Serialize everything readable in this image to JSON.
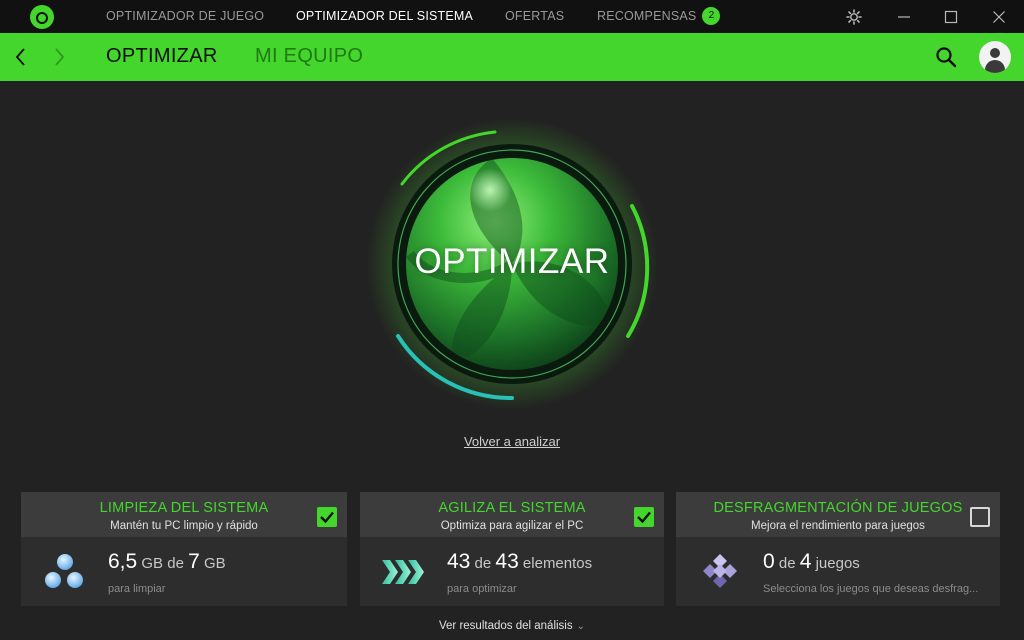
{
  "titlebar": {
    "tabs": [
      {
        "label": "OPTIMIZADOR DE JUEGO"
      },
      {
        "label": "OPTIMIZADOR DEL SISTEMA"
      },
      {
        "label": "OFERTAS"
      },
      {
        "label": "RECOMPENSAS",
        "badge": "2"
      }
    ],
    "active_tab": "OPTIMIZADOR DEL SISTEMA"
  },
  "nav": {
    "tabs": [
      {
        "label": "OPTIMIZAR"
      },
      {
        "label": "MI EQUIPO"
      }
    ],
    "active_tab": "OPTIMIZAR",
    "icons": [
      "back-arrow-icon",
      "forward-arrow-icon",
      "search-icon",
      "avatar-icon"
    ]
  },
  "main": {
    "optimize_label": "OPTIMIZAR",
    "reanalyze_label": "Volver a analizar"
  },
  "cards": [
    {
      "title": "LIMPIEZA DEL SISTEMA",
      "subtitle": "Mantén tu PC limpio y rápido",
      "checked": true,
      "stat": {
        "value1": "6,5",
        "unit1": "GB",
        "connector": "de",
        "value2": "7",
        "unit2": "GB"
      },
      "stat_sub": "para limpiar",
      "icon": "bubbles-icon"
    },
    {
      "title": "AGILIZA EL SISTEMA",
      "subtitle": "Optimiza para agilizar el PC",
      "checked": true,
      "stat": {
        "value1": "43",
        "connector": "de",
        "value2": "43",
        "unit2": "elementos"
      },
      "stat_sub": "para optimizar",
      "icon": "chevrons-icon"
    },
    {
      "title": "DESFRAGMENTACIÓN DE JUEGOS",
      "subtitle": "Mejora el rendimiento para juegos",
      "checked": false,
      "stat": {
        "value1": "0",
        "connector": "de",
        "value2": "4",
        "unit2": "juegos"
      },
      "stat_sub": "Selecciona los juegos que deseas desfrag...",
      "icon": "diamonds-icon"
    }
  ],
  "footer": {
    "results_label": "Ver resultados del análisis"
  },
  "colors": {
    "accent": "#44d62c",
    "titlebar_bg": "#111111",
    "page_bg": "#222222",
    "card_head_bg": "#3c3c3c",
    "card_body_bg": "#2d2d2d",
    "ring_teal": "#27c1b6"
  }
}
